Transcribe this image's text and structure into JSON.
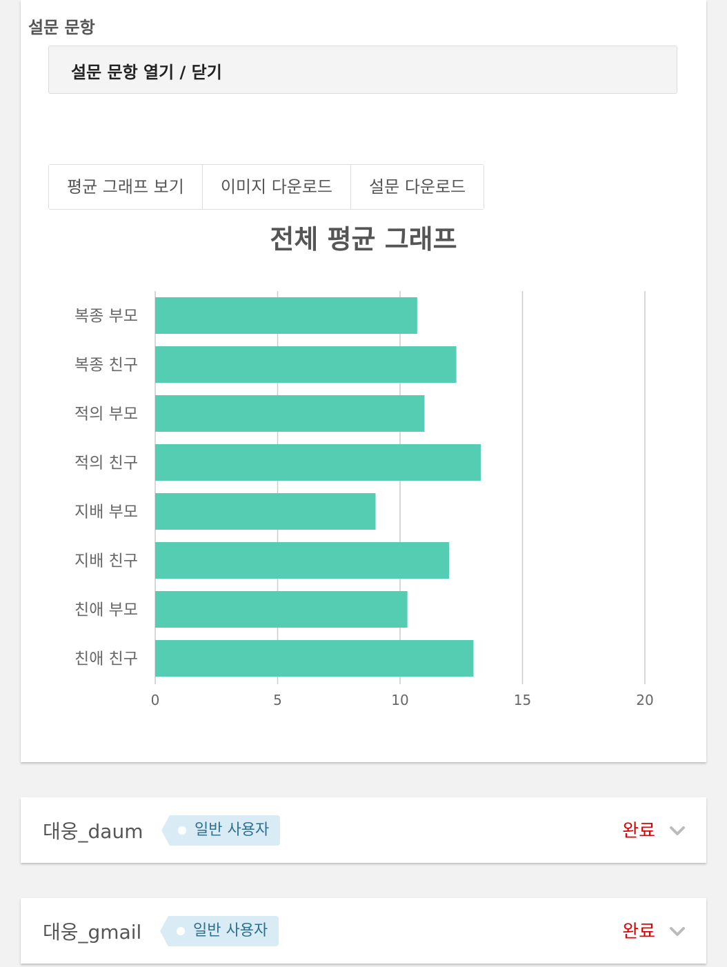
{
  "survey": {
    "section_label": "설문 문항",
    "toggle_label": "설문 문항 열기 / 닫기",
    "buttons": {
      "average_graph": "평균 그래프 보기",
      "image_download": "이미지 다운로드",
      "survey_download": "설문 다운로드"
    }
  },
  "chart_data": {
    "type": "bar",
    "orientation": "horizontal",
    "title": "전체 평균 그래프",
    "categories": [
      "복종 부모",
      "복종 친구",
      "적의 부모",
      "적의 친구",
      "지배 부모",
      "지배 친구",
      "친애 부모",
      "친애 친구"
    ],
    "values": [
      10.7,
      12.3,
      11.0,
      13.3,
      9.0,
      12.0,
      10.3,
      13.0
    ],
    "xlim": [
      0,
      20
    ],
    "xticks": [
      0,
      5,
      10,
      15,
      20
    ],
    "grid": true,
    "colors": {
      "bar": "#55cdb3",
      "grid": "#cccccc",
      "label": "#666666"
    }
  },
  "users": [
    {
      "name": "대웅_daum",
      "tag": "일반 사용자",
      "status": "완료"
    },
    {
      "name": "대웅_gmail",
      "tag": "일반 사용자",
      "status": "완료"
    }
  ],
  "colors": {
    "status": "#e00000",
    "tag_bg": "#d9ecf5",
    "tag_text": "#2d6f8f"
  },
  "icons": {
    "expand": "chevron-down-icon"
  }
}
